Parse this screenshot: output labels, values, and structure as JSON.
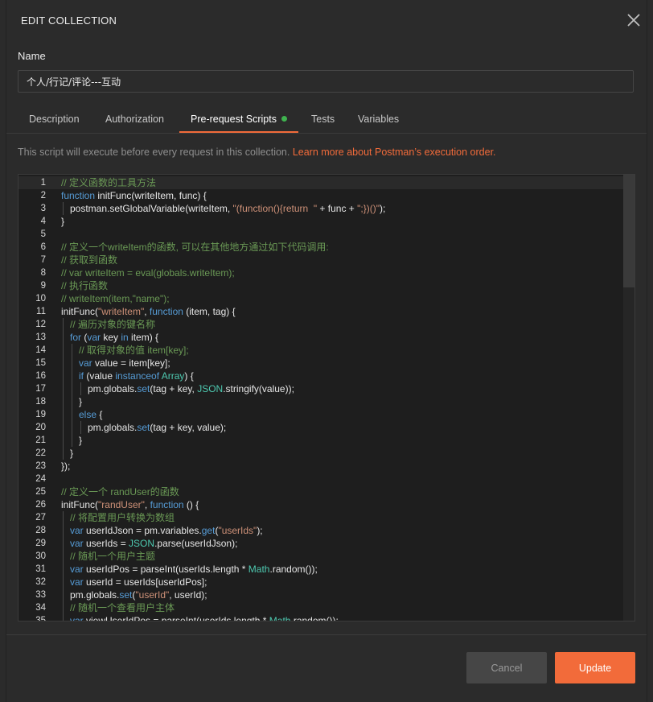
{
  "modal": {
    "title": "EDIT COLLECTION",
    "close_icon": "close-icon"
  },
  "name_field": {
    "label": "Name",
    "value": "个人/行记/评论---互动"
  },
  "tabs": [
    {
      "label": "Description",
      "active": false
    },
    {
      "label": "Authorization",
      "active": false
    },
    {
      "label": "Pre-request Scripts",
      "active": true,
      "has_dot": true,
      "dot_color": "#3fb34f"
    },
    {
      "label": "Tests",
      "active": false
    },
    {
      "label": "Variables",
      "active": false
    }
  ],
  "hint": {
    "text": "This script will execute before every request in this collection. ",
    "link": "Learn more about Postman’s execution order."
  },
  "editor": {
    "lines": [
      {
        "n": "1",
        "i": 0,
        "t": [
          [
            "c",
            "// 定义函数的工具方法"
          ]
        ]
      },
      {
        "n": "2",
        "i": 0,
        "t": [
          [
            "k",
            "function"
          ],
          [
            "p",
            " initFunc(writeItem, func) {"
          ]
        ]
      },
      {
        "n": "3",
        "i": 1,
        "t": [
          [
            "p",
            "postman.setGlobalVariable(writeItem, "
          ],
          [
            "s",
            "\"(function(){return  \""
          ],
          [
            "p",
            " + func + "
          ],
          [
            "s",
            "\";})()\""
          ],
          [
            "p",
            ");"
          ]
        ]
      },
      {
        "n": "4",
        "i": 0,
        "t": [
          [
            "p",
            "}"
          ]
        ]
      },
      {
        "n": "5",
        "i": 0,
        "t": []
      },
      {
        "n": "6",
        "i": 0,
        "t": [
          [
            "c",
            "// 定义一个writeItem的函数, 可以在其他地方通过如下代码调用:"
          ]
        ]
      },
      {
        "n": "7",
        "i": 0,
        "t": [
          [
            "c",
            "// 获取到函数"
          ]
        ]
      },
      {
        "n": "8",
        "i": 0,
        "t": [
          [
            "c",
            "// var writeItem = eval(globals.writeItem);"
          ]
        ]
      },
      {
        "n": "9",
        "i": 0,
        "t": [
          [
            "c",
            "// 执行函数"
          ]
        ]
      },
      {
        "n": "10",
        "i": 0,
        "t": [
          [
            "c",
            "// writeItem(item,\"name\");"
          ]
        ]
      },
      {
        "n": "11",
        "i": 0,
        "t": [
          [
            "p",
            "initFunc("
          ],
          [
            "s",
            "\"writeItem\""
          ],
          [
            "p",
            ", "
          ],
          [
            "k",
            "function"
          ],
          [
            "p",
            " (item, tag) {"
          ]
        ]
      },
      {
        "n": "12",
        "i": 1,
        "t": [
          [
            "c",
            "// 遍历对象的键名称"
          ]
        ]
      },
      {
        "n": "13",
        "i": 1,
        "t": [
          [
            "k",
            "for"
          ],
          [
            "p",
            " ("
          ],
          [
            "k",
            "var"
          ],
          [
            "p",
            " key "
          ],
          [
            "k",
            "in"
          ],
          [
            "p",
            " item) {"
          ]
        ]
      },
      {
        "n": "14",
        "i": 2,
        "t": [
          [
            "c",
            "// 取得对象的值 item[key];"
          ]
        ]
      },
      {
        "n": "15",
        "i": 2,
        "t": [
          [
            "k",
            "var"
          ],
          [
            "p",
            " value = item[key];"
          ]
        ]
      },
      {
        "n": "16",
        "i": 2,
        "t": [
          [
            "k",
            "if"
          ],
          [
            "p",
            " (value "
          ],
          [
            "k",
            "instanceof"
          ],
          [
            "p",
            " "
          ],
          [
            "t",
            "Array"
          ],
          [
            "p",
            ") {"
          ]
        ]
      },
      {
        "n": "17",
        "i": 3,
        "t": [
          [
            "p",
            "pm.globals."
          ],
          [
            "f",
            "set"
          ],
          [
            "p",
            "(tag + key, "
          ],
          [
            "t",
            "JSON"
          ],
          [
            "p",
            ".stringify(value));"
          ]
        ]
      },
      {
        "n": "18",
        "i": 2,
        "t": [
          [
            "p",
            "}"
          ]
        ]
      },
      {
        "n": "19",
        "i": 2,
        "t": [
          [
            "k",
            "else"
          ],
          [
            "p",
            " {"
          ]
        ]
      },
      {
        "n": "20",
        "i": 3,
        "t": [
          [
            "p",
            "pm.globals."
          ],
          [
            "f",
            "set"
          ],
          [
            "p",
            "(tag + key, value);"
          ]
        ]
      },
      {
        "n": "21",
        "i": 2,
        "t": [
          [
            "p",
            "}"
          ]
        ]
      },
      {
        "n": "22",
        "i": 1,
        "t": [
          [
            "p",
            "}"
          ]
        ]
      },
      {
        "n": "23",
        "i": 0,
        "t": [
          [
            "p",
            "});"
          ]
        ]
      },
      {
        "n": "24",
        "i": 0,
        "t": []
      },
      {
        "n": "25",
        "i": 0,
        "t": [
          [
            "c",
            "// 定义一个 randUser的函数"
          ]
        ]
      },
      {
        "n": "26",
        "i": 0,
        "t": [
          [
            "p",
            "initFunc("
          ],
          [
            "s",
            "\"randUser\""
          ],
          [
            "p",
            ", "
          ],
          [
            "k",
            "function"
          ],
          [
            "p",
            " () {"
          ]
        ]
      },
      {
        "n": "27",
        "i": 1,
        "t": [
          [
            "c",
            "// 将配置用户转换为数组"
          ]
        ]
      },
      {
        "n": "28",
        "i": 1,
        "t": [
          [
            "k",
            "var"
          ],
          [
            "p",
            " userIdJson = pm.variables."
          ],
          [
            "f",
            "get"
          ],
          [
            "p",
            "("
          ],
          [
            "s",
            "\"userIds\""
          ],
          [
            "p",
            ");"
          ]
        ]
      },
      {
        "n": "29",
        "i": 1,
        "t": [
          [
            "k",
            "var"
          ],
          [
            "p",
            " userIds = "
          ],
          [
            "t",
            "JSON"
          ],
          [
            "p",
            ".parse(userIdJson);"
          ]
        ]
      },
      {
        "n": "30",
        "i": 1,
        "t": [
          [
            "c",
            "// 随机一个用户主题"
          ]
        ]
      },
      {
        "n": "31",
        "i": 1,
        "t": [
          [
            "k",
            "var"
          ],
          [
            "p",
            " userIdPos = parseInt(userIds.length * "
          ],
          [
            "t",
            "Math"
          ],
          [
            "p",
            ".random());"
          ]
        ]
      },
      {
        "n": "32",
        "i": 1,
        "t": [
          [
            "k",
            "var"
          ],
          [
            "p",
            " userId = userIds[userIdPos];"
          ]
        ]
      },
      {
        "n": "33",
        "i": 1,
        "t": [
          [
            "p",
            "pm.globals."
          ],
          [
            "f",
            "set"
          ],
          [
            "p",
            "("
          ],
          [
            "s",
            "\"userId\""
          ],
          [
            "p",
            ", userId);"
          ]
        ]
      },
      {
        "n": "34",
        "i": 1,
        "t": [
          [
            "c",
            "// 随机一个查看用户主体"
          ]
        ]
      },
      {
        "n": "35",
        "i": 1,
        "t": [
          [
            "k",
            "var"
          ],
          [
            "p",
            " viewUserIdPos = parseInt(userIds.length * "
          ],
          [
            "t",
            "Math"
          ],
          [
            "p",
            ".random());"
          ]
        ]
      }
    ],
    "scroll_position": 0.0
  },
  "footer": {
    "cancel_label": "Cancel",
    "update_label": "Update"
  },
  "colors": {
    "accent": "#f26b3a",
    "background": "#2b2b2b",
    "editor_bg": "#1e1e1e"
  }
}
